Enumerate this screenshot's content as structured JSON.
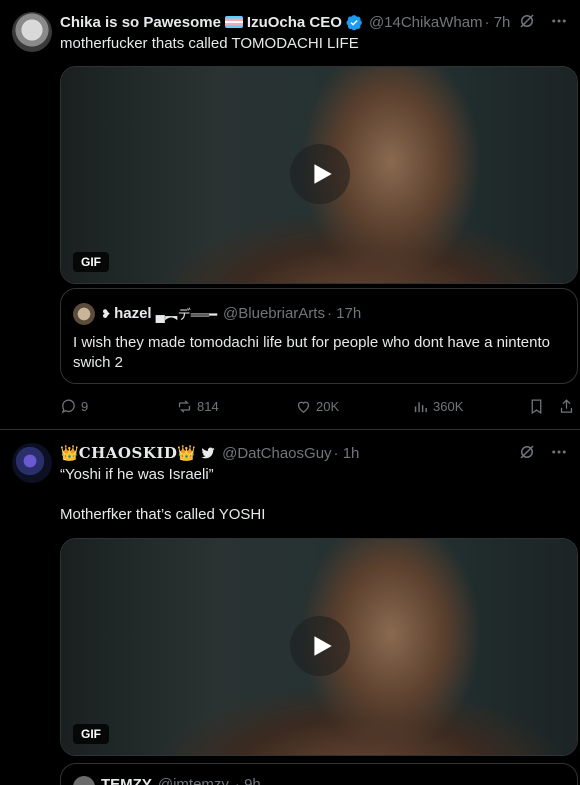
{
  "tweets": [
    {
      "author_name": "Chika is so Pawesome",
      "author_name_2": "IzuOcha CEO",
      "handle": "@14ChikaWham",
      "time": "· 7h",
      "text": "motherfucker thats called TOMODACHI LIFE",
      "media_badge": "GIF",
      "quote": {
        "author": "hazel",
        "author_suffix": "▄︻デ══━",
        "handle": "@BluebriarArts",
        "time": "· 17h",
        "text": "I wish they made tomodachi life but for people who dont have a nintento swich 2"
      },
      "stats": {
        "replies": "9",
        "retweets": "814",
        "likes": "20K",
        "views": "360K"
      }
    },
    {
      "author_name": "CHAOSKID",
      "crown": "👑",
      "handle": "@DatChaosGuy",
      "time": "· 1h",
      "text": "“Yoshi if he was Israeli”\n\nMotherfker that’s called YOSHI",
      "media_badge": "GIF",
      "quote_partial": {
        "author": "TEMZY",
        "handle": "@imtemzy",
        "time": "· 9h"
      }
    }
  ],
  "colors": {
    "accent": "#1d9bf0",
    "muted": "#71767b",
    "text": "#e7e9ea",
    "border": "#2f3336"
  }
}
